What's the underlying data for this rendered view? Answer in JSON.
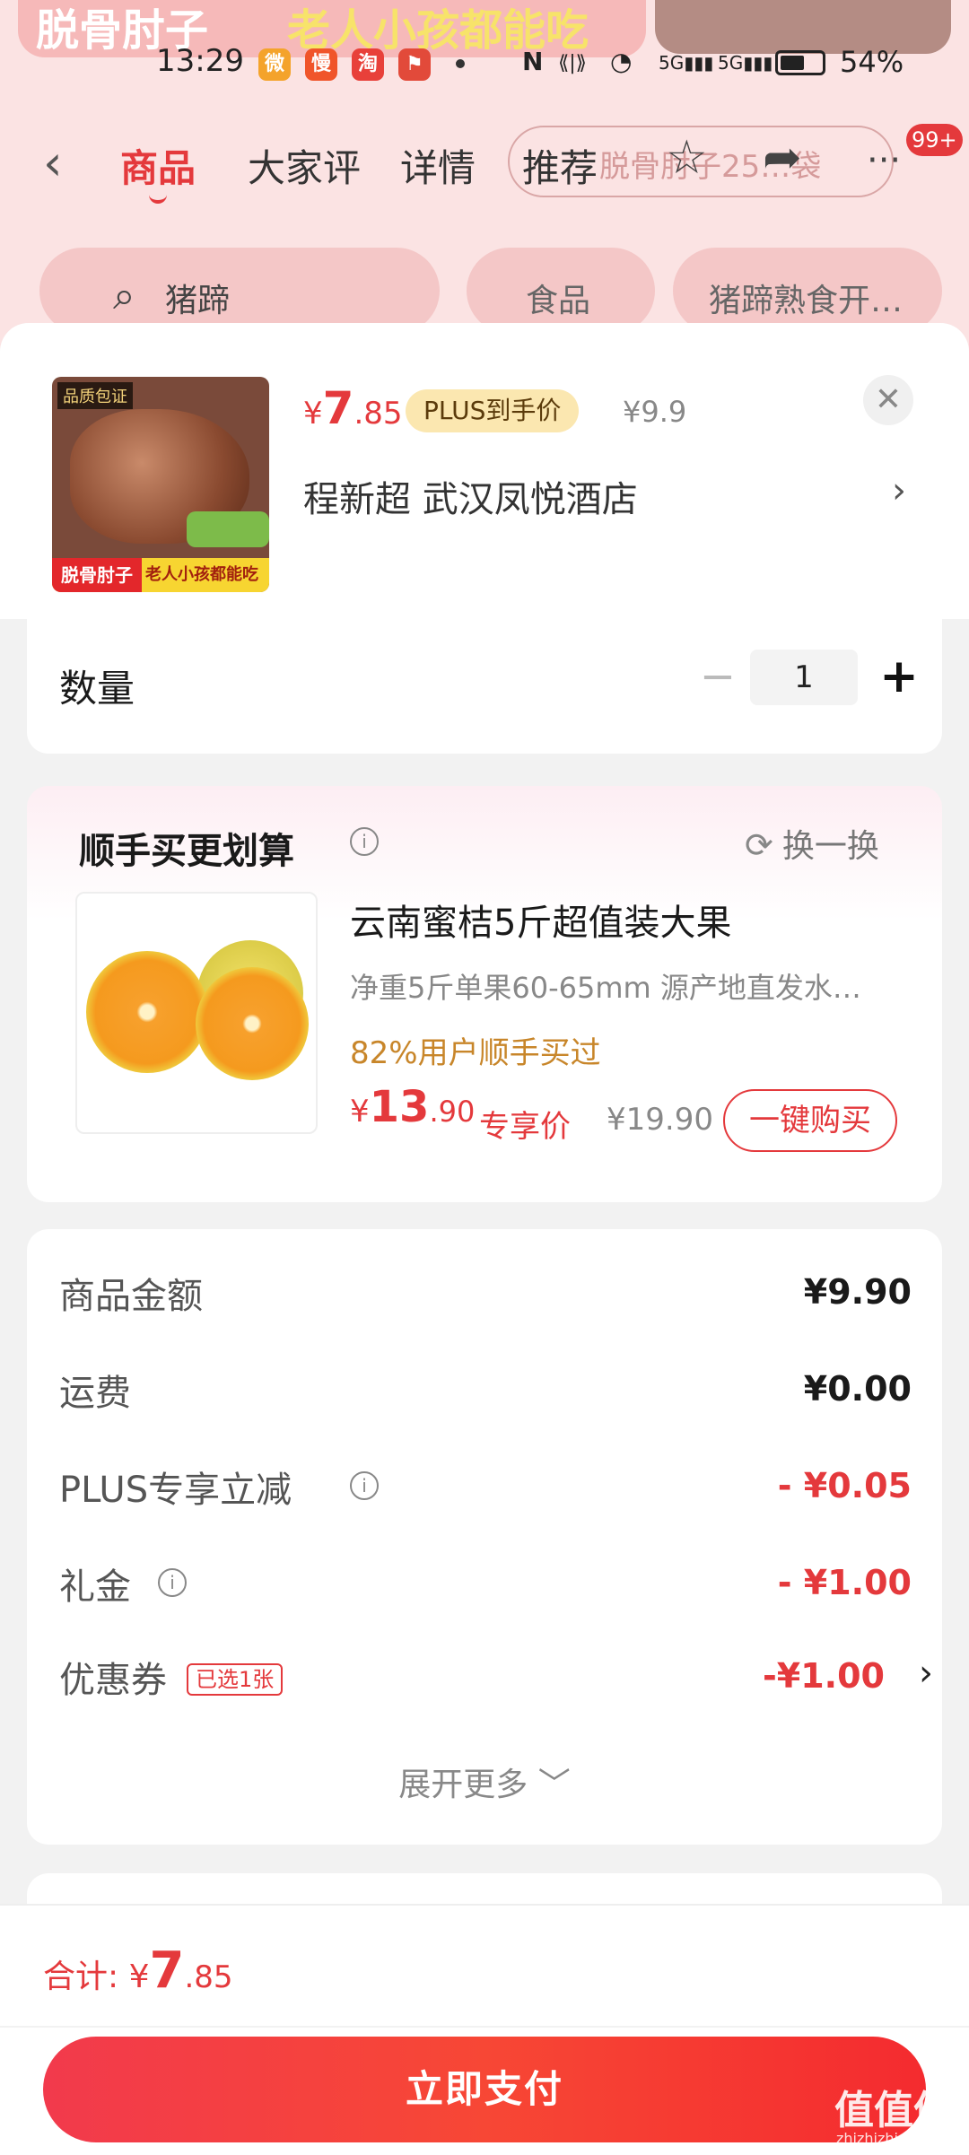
{
  "background": {
    "banner_left": "脱骨肘子",
    "banner_right": "老人小孩都能吃",
    "status": {
      "time": "13:29",
      "apps": [
        "微",
        "慢",
        "淘",
        "⚑"
      ],
      "nfc": "N",
      "vibrate": "⟪|⟫",
      "wifi": "◔",
      "signal1": "5G▮▮▮",
      "signal2": "5G▮▮▮",
      "battery": "54%"
    },
    "nav": {
      "tab_goods": "商品",
      "tab_reviews": "大家评",
      "tab_details": "详情",
      "tab_recommend": "推荐",
      "search_hint": "脱骨肘子25…袋",
      "more": "···",
      "badge": "99+"
    },
    "filters": {
      "search_term": "猪蹄",
      "category": "食品",
      "subcategory": "猪蹄熟食开…"
    }
  },
  "sheet": {
    "product": {
      "image_tag": "品质包证",
      "image_strip_red": "脱骨肘子",
      "image_strip_yellow": "老人小孩都能吃",
      "price_currency": "¥",
      "price_int": "7",
      "price_dec": ".85",
      "plus_tag": "PLUS到手价",
      "original_price": "¥9.9",
      "shop_name": "程新超  武汉凤悦酒店",
      "shop_arrow": "›",
      "close": "✕"
    },
    "quantity": {
      "label": "数量",
      "minus": "−",
      "value": "1",
      "plus": "+"
    },
    "upsell": {
      "title": "顺手买更划算",
      "info": "i",
      "refresh_icon": "⟳",
      "refresh_label": "换一换",
      "name": "云南蜜桔5斤超值装大果",
      "desc": "净重5斤单果60-65mm    源产地直发水…",
      "pct": "82%用户顺手买过",
      "price_currency": "¥",
      "price_int": "13",
      "price_dec": ".90",
      "exclusive_label": "专享价",
      "original_price": "¥19.90",
      "buy_label": "一键购买"
    },
    "summary": {
      "rows": [
        {
          "label": "商品金额",
          "value": "¥9.90"
        },
        {
          "label": "运费",
          "value": "¥0.00"
        },
        {
          "label": "PLUS专享立减",
          "value": "- ¥0.05"
        },
        {
          "label": "礼金",
          "value": "- ¥1.00"
        },
        {
          "label": "优惠券",
          "value": "-¥1.00"
        }
      ],
      "coupon_tag": "已选1张",
      "coupon_arrow": "›",
      "info": "i",
      "expand": "展开更多 ﹀"
    }
  },
  "footer": {
    "total_label": "合计: ",
    "total_currency": "¥",
    "total_int": "7",
    "total_dec": ".85",
    "pay_button": "立即支付",
    "watermark_big": "值值值",
    "watermark_small": "zhizhizhi.com"
  },
  "colors": {
    "accent": "#e4393c",
    "plus_tag_bg": "#fbe7b0",
    "popular_text": "#c8862a"
  }
}
